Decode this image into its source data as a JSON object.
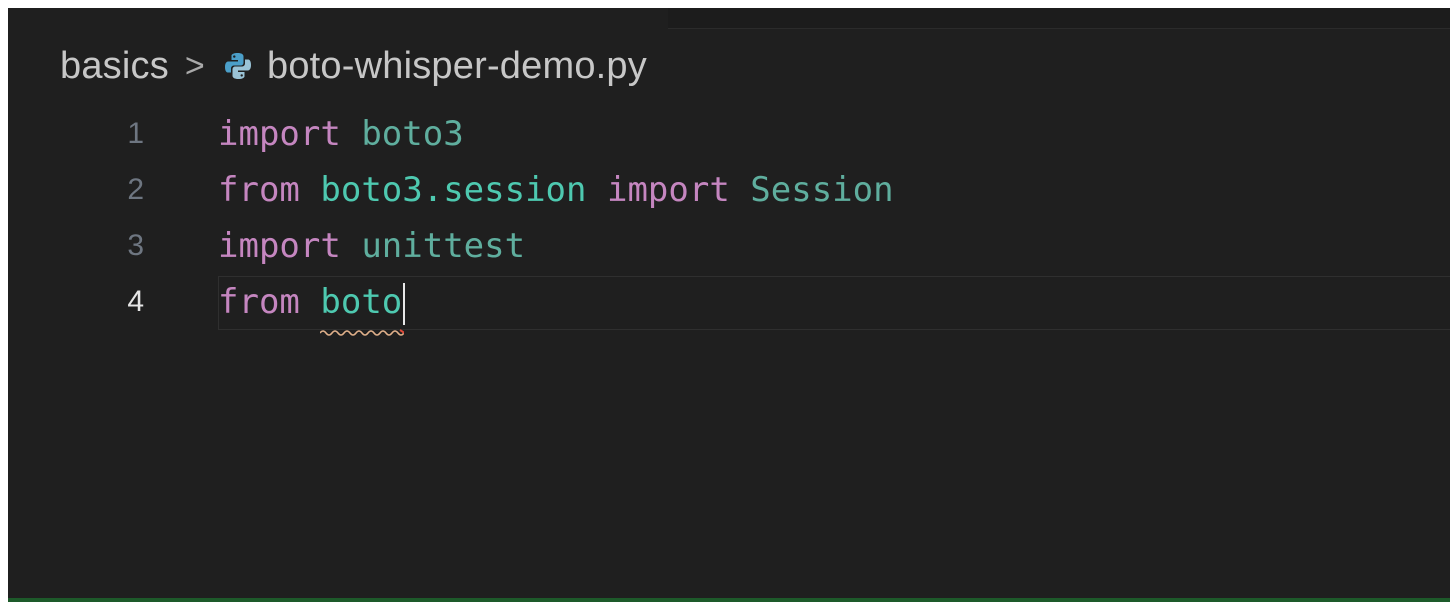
{
  "breadcrumb": {
    "folder": "basics",
    "separator": ">",
    "file": "boto-whisper-demo.py",
    "file_icon": "python-icon"
  },
  "editor": {
    "current_line": 4,
    "lines": [
      {
        "number": "1",
        "tokens": [
          "import",
          " ",
          "boto3"
        ]
      },
      {
        "number": "2",
        "tokens": [
          "from",
          " ",
          "boto3",
          ".session",
          " ",
          "import",
          " ",
          "Session"
        ]
      },
      {
        "number": "3",
        "tokens": [
          "import",
          " ",
          "unittest"
        ]
      },
      {
        "number": "4",
        "tokens": [
          "from",
          " ",
          "boto"
        ]
      }
    ]
  },
  "colors": {
    "background": "#1f1f1f",
    "keyword": "#c586c0",
    "module": "#4ec9b0",
    "line_number": "#6e7681",
    "status_bar": "#1d5a2a"
  }
}
